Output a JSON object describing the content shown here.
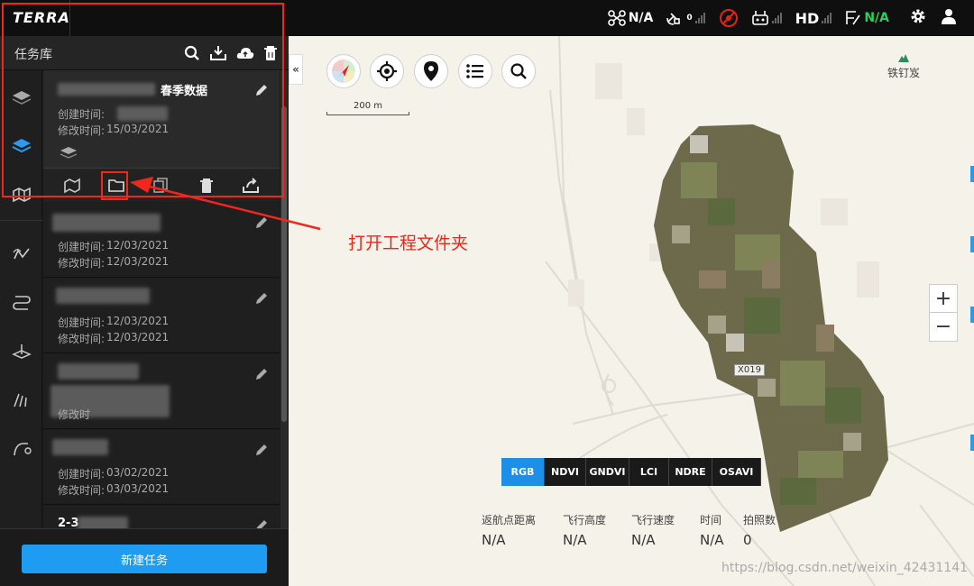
{
  "app": {
    "logo": "TERRA"
  },
  "status_bar": {
    "drone": {
      "icon": "drone-icon",
      "value": "N/A"
    },
    "gps": {
      "icon": "satellite-icon",
      "count": "0"
    },
    "rc": {
      "icon": "no-signal-icon"
    },
    "controller": {
      "icon": "remote-controller-icon"
    },
    "video": {
      "label": "HD"
    },
    "mode": {
      "icon": "flight-mode-icon",
      "value": "N/A"
    },
    "settings_icon": "gear-icon",
    "user_icon": "user-icon"
  },
  "sidebar": {
    "title": "任务库",
    "head_icons": [
      "search-icon",
      "import-icon",
      "cloud-upload-icon",
      "trash-icon"
    ],
    "rail_icons": [
      "layers-icon",
      "layers-active-icon",
      "map-3d-icon",
      "route-icon",
      "waypoint-route-icon",
      "oblique-icon",
      "corridor-icon",
      "mapping-curve-icon"
    ],
    "tasks": [
      {
        "name_tail": "春季数据",
        "created_label": "创建时间:",
        "created": "",
        "modified_label": "修改时间:",
        "modified": "15/03/2021"
      },
      {
        "name_tail": "",
        "created_label": "创建时间:",
        "created": "12/03/2021",
        "modified_label": "修改时间:",
        "modified": "12/03/2021"
      },
      {
        "name_tail": "",
        "created_label": "创建时间:",
        "created": "12/03/2021",
        "modified_label": "修改时间:",
        "modified": "12/03/2021"
      },
      {
        "name_tail": "",
        "created_label": "",
        "created": "",
        "modified_label": "修改时",
        "modified": ""
      },
      {
        "name_tail": "",
        "created_label": "创建时间:",
        "created": "03/02/2021",
        "modified_label": "修改时间:",
        "modified": "03/03/2021"
      },
      {
        "name_tail": "2-3",
        "created_label": "",
        "created": "",
        "modified_label": "",
        "modified": ""
      }
    ],
    "task_tools": [
      "map-3d-icon",
      "folder-icon",
      "copy-icon",
      "trash-icon",
      "export-icon"
    ],
    "new_task_label": "新建任务"
  },
  "annotation": {
    "label": "打开工程文件夹",
    "color": "#f0271c"
  },
  "map": {
    "collapse_label": "«",
    "buttons": [
      "compass-icon",
      "locate-icon",
      "pin-icon",
      "list-icon",
      "search-icon"
    ],
    "scale_label": "200 m",
    "place_name": "铁钉岌",
    "road_label": "X019",
    "zoom_in": "+",
    "zoom_out": "−",
    "bands": [
      "RGB",
      "NDVI",
      "GNDVI",
      "LCI",
      "NDRE",
      "OSAVI"
    ],
    "selected_band": "RGB",
    "stats": [
      {
        "label": "返航点距离",
        "value": "N/A"
      },
      {
        "label": "飞行高度",
        "value": "N/A"
      },
      {
        "label": "飞行速度",
        "value": "N/A"
      },
      {
        "label": "时间",
        "value": "N/A"
      },
      {
        "label": "拍照数",
        "value": "0"
      }
    ],
    "watermark": "https://blog.csdn.net/weixin_42431141"
  }
}
